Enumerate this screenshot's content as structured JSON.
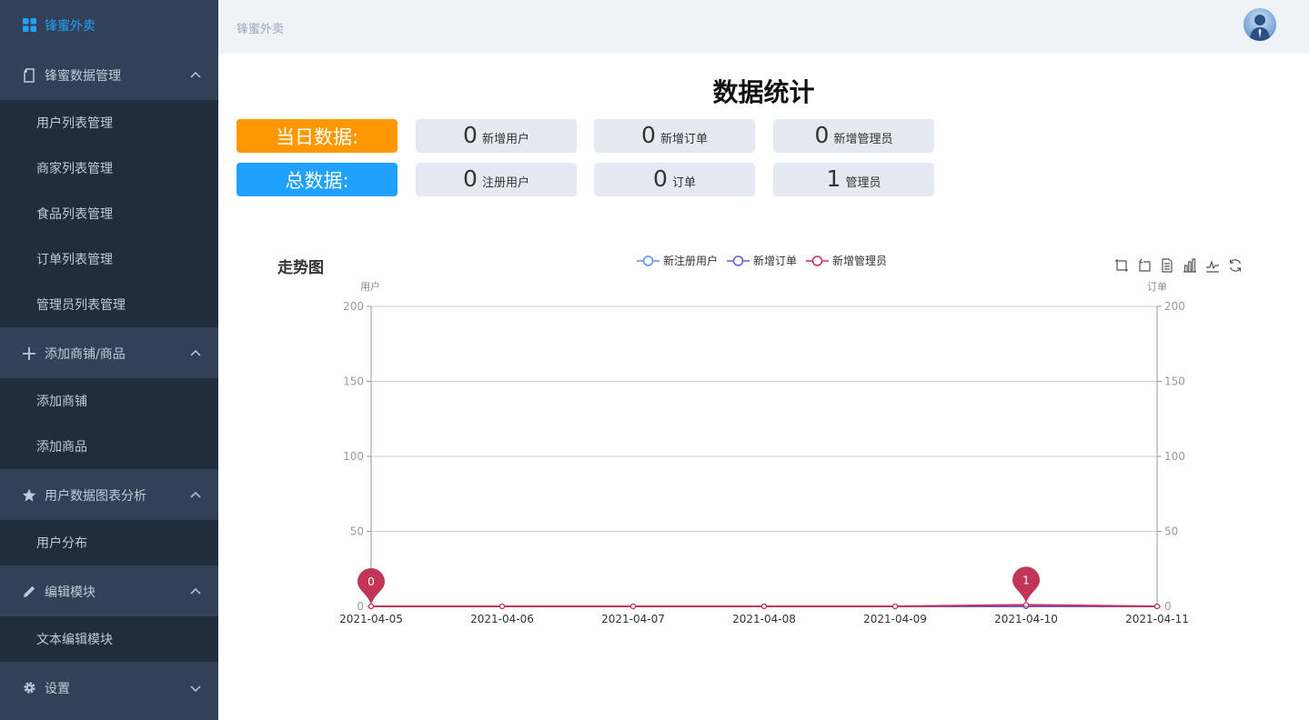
{
  "sidebar": {
    "brand": "锋蜜外卖",
    "groups": [
      {
        "label": "锋蜜数据管理",
        "items": [
          "用户列表管理",
          "商家列表管理",
          "食品列表管理",
          "订单列表管理",
          "管理员列表管理"
        ]
      },
      {
        "label": "添加商铺/商品",
        "items": [
          "添加商铺",
          "添加商品"
        ]
      },
      {
        "label": "用户数据图表分析",
        "items": [
          "用户分布"
        ]
      },
      {
        "label": "编辑模块",
        "items": [
          "文本编辑模块"
        ]
      },
      {
        "label": "设置",
        "items": []
      }
    ]
  },
  "header": {
    "breadcrumb": "锋蜜外卖"
  },
  "main": {
    "title": "数据统计",
    "today_label": "当日数据:",
    "total_label": "总数据:",
    "today": [
      {
        "value": "0",
        "label": "新增用户"
      },
      {
        "value": "0",
        "label": "新增订单"
      },
      {
        "value": "0",
        "label": "新增管理员"
      }
    ],
    "total": [
      {
        "value": "0",
        "label": "注册用户"
      },
      {
        "value": "0",
        "label": "订单"
      },
      {
        "value": "1",
        "label": "管理员"
      }
    ],
    "chart_heading": "走势图"
  },
  "colors": {
    "sidebar_bg": "#324157",
    "submenu_bg": "#1f2d3d",
    "active": "#20a0ff",
    "today_label_bg": "#ff9800",
    "total_label_bg": "#20a0ff",
    "stat_box_bg": "#e5e9f2"
  },
  "chart_data": {
    "type": "line",
    "categories": [
      "2021-04-05",
      "2021-04-06",
      "2021-04-07",
      "2021-04-08",
      "2021-04-09",
      "2021-04-10",
      "2021-04-11"
    ],
    "series": [
      {
        "name": "新注册用户",
        "values": [
          0,
          0,
          0,
          0,
          0,
          0,
          0
        ],
        "color": "#5b8ff9",
        "axis": "left"
      },
      {
        "name": "新增订单",
        "values": [
          0,
          0,
          0,
          0,
          0,
          0,
          0
        ],
        "color": "#6e5ac5",
        "axis": "right"
      },
      {
        "name": "新增管理员",
        "values": [
          0,
          0,
          0,
          0,
          0,
          1,
          0
        ],
        "color": "#c23557",
        "axis": "left"
      }
    ],
    "markers": [
      {
        "category": "2021-04-05",
        "label": "0"
      },
      {
        "category": "2021-04-10",
        "label": "1"
      }
    ],
    "y_left_label": "用户",
    "y_right_label": "订单",
    "ylim": [
      0,
      200
    ],
    "yticks": [
      0,
      50,
      100,
      150,
      200
    ],
    "legend_position": "top-center",
    "grid": true
  },
  "toolbox": [
    "zoom-icon",
    "zoom-reset-icon",
    "data-view-icon",
    "bar-chart-icon",
    "line-chart-icon",
    "restore-icon"
  ]
}
